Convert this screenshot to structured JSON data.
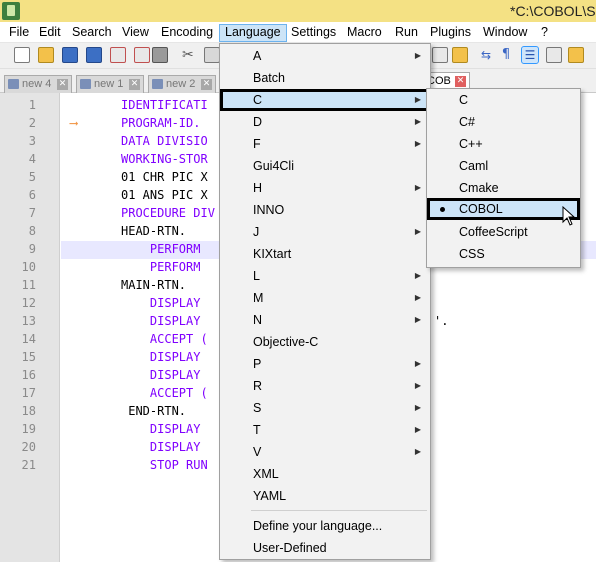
{
  "window": {
    "title": "*C:\\COBOL\\S"
  },
  "menubar": {
    "items": [
      "File",
      "Edit",
      "Search",
      "View",
      "Encoding",
      "Language",
      "Settings",
      "Macro",
      "Run",
      "Plugins",
      "Window",
      "?"
    ],
    "active": "Language"
  },
  "tabs": [
    {
      "label": "new 4",
      "active": false
    },
    {
      "label": "new 1",
      "active": false
    },
    {
      "label": "new 2",
      "active": false
    },
    {
      "label": "COB",
      "active": true
    }
  ],
  "editor": {
    "line_numbers": [
      "1",
      "2",
      "3",
      "4",
      "5",
      "6",
      "7",
      "8",
      "9",
      "10",
      "11",
      "12",
      "13",
      "14",
      "15",
      "16",
      "17",
      "18",
      "19",
      "20",
      "21"
    ],
    "lines": [
      "IDENTIFICATI",
      "PROGRAM-ID.",
      "DATA DIVISIO",
      "WORKING-STOR",
      "01 CHR PIC X",
      "01 ANS PIC X",
      "PROCEDURE DIV",
      "HEAD-RTN.",
      "    PERFORM ",
      "    PERFORM ",
      "MAIN-RTN.",
      "    DISPLAY",
      "    DISPLAY",
      "    ACCEPT (",
      "    DISPLAY",
      "    DISPLAY",
      "    ACCEPT (",
      " END-RTN.",
      "    DISPLAY",
      "    DISPLAY",
      "    STOP RUN"
    ],
    "trailing_fragment": "'."
  },
  "language_menu": {
    "items": [
      {
        "label": "A",
        "submenu": true
      },
      {
        "label": "Batch",
        "submenu": false
      },
      {
        "label": "C",
        "submenu": true,
        "highlighted": true
      },
      {
        "label": "D",
        "submenu": true
      },
      {
        "label": "F",
        "submenu": true
      },
      {
        "label": "Gui4Cli",
        "submenu": false
      },
      {
        "label": "H",
        "submenu": true
      },
      {
        "label": "INNO",
        "submenu": false
      },
      {
        "label": "J",
        "submenu": true
      },
      {
        "label": "KIXtart",
        "submenu": false
      },
      {
        "label": "L",
        "submenu": true
      },
      {
        "label": "M",
        "submenu": true
      },
      {
        "label": "N",
        "submenu": true
      },
      {
        "label": "Objective-C",
        "submenu": false
      },
      {
        "label": "P",
        "submenu": true
      },
      {
        "label": "R",
        "submenu": true
      },
      {
        "label": "S",
        "submenu": true
      },
      {
        "label": "T",
        "submenu": true
      },
      {
        "label": "V",
        "submenu": true
      },
      {
        "label": "XML",
        "submenu": false
      },
      {
        "label": "YAML",
        "submenu": false
      }
    ],
    "footer_items": [
      "Define your language...",
      "User-Defined"
    ]
  },
  "c_submenu": {
    "items": [
      "C",
      "C#",
      "C++",
      "Caml",
      "Cmake",
      "COBOL",
      "CoffeeScript",
      "CSS"
    ],
    "selected": "COBOL"
  }
}
